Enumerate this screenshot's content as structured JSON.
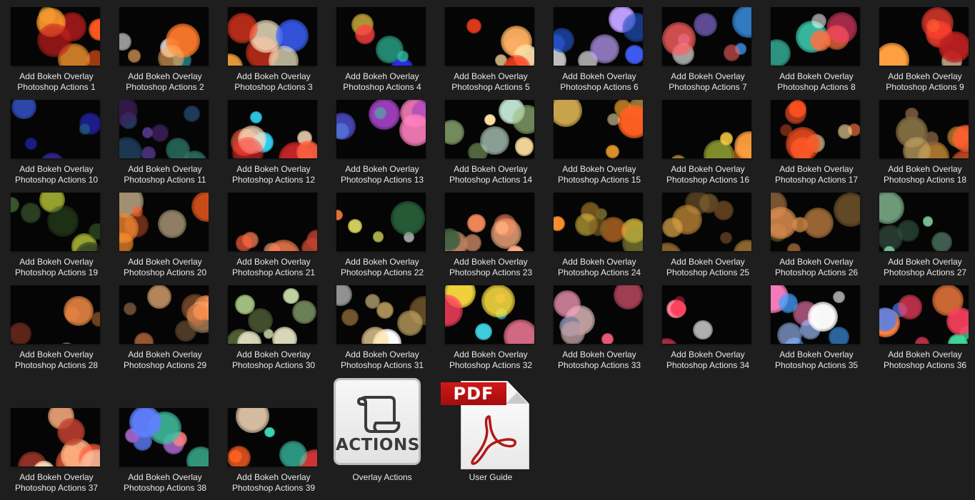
{
  "items": [
    {
      "line1": "Add Bokeh Overlay",
      "line2": "Photoshop Actions 1",
      "type": "image"
    },
    {
      "line1": "Add Bokeh Overlay",
      "line2": "Photoshop Actions 2",
      "type": "image"
    },
    {
      "line1": "Add Bokeh Overlay",
      "line2": "Photoshop Actions 3",
      "type": "image"
    },
    {
      "line1": "Add Bokeh Overlay",
      "line2": "Photoshop Actions 4",
      "type": "image"
    },
    {
      "line1": "Add Bokeh Overlay",
      "line2": "Photoshop Actions 5",
      "type": "image"
    },
    {
      "line1": "Add Bokeh Overlay",
      "line2": "Photoshop Actions 6",
      "type": "image"
    },
    {
      "line1": "Add Bokeh Overlay",
      "line2": "Photoshop Actions 7",
      "type": "image"
    },
    {
      "line1": "Add Bokeh Overlay",
      "line2": "Photoshop Actions 8",
      "type": "image"
    },
    {
      "line1": "Add Bokeh Overlay",
      "line2": "Photoshop Actions 9",
      "type": "image"
    },
    {
      "line1": "Add Bokeh Overlay",
      "line2": "Photoshop Actions 10",
      "type": "image"
    },
    {
      "line1": "Add Bokeh Overlay",
      "line2": "Photoshop Actions 11",
      "type": "image"
    },
    {
      "line1": "Add Bokeh Overlay",
      "line2": "Photoshop Actions 12",
      "type": "image"
    },
    {
      "line1": "Add Bokeh Overlay",
      "line2": "Photoshop Actions 13",
      "type": "image"
    },
    {
      "line1": "Add Bokeh Overlay",
      "line2": "Photoshop Actions 14",
      "type": "image"
    },
    {
      "line1": "Add Bokeh Overlay",
      "line2": "Photoshop Actions 15",
      "type": "image"
    },
    {
      "line1": "Add Bokeh Overlay",
      "line2": "Photoshop Actions 16",
      "type": "image"
    },
    {
      "line1": "Add Bokeh Overlay",
      "line2": "Photoshop Actions 17",
      "type": "image"
    },
    {
      "line1": "Add Bokeh Overlay",
      "line2": "Photoshop Actions 18",
      "type": "image"
    },
    {
      "line1": "Add Bokeh Overlay",
      "line2": "Photoshop Actions 19",
      "type": "image"
    },
    {
      "line1": "Add Bokeh Overlay",
      "line2": "Photoshop Actions 20",
      "type": "image"
    },
    {
      "line1": "Add Bokeh Overlay",
      "line2": "Photoshop Actions 21",
      "type": "image"
    },
    {
      "line1": "Add Bokeh Overlay",
      "line2": "Photoshop Actions 22",
      "type": "image"
    },
    {
      "line1": "Add Bokeh Overlay",
      "line2": "Photoshop Actions 23",
      "type": "image"
    },
    {
      "line1": "Add Bokeh Overlay",
      "line2": "Photoshop Actions 24",
      "type": "image"
    },
    {
      "line1": "Add Bokeh Overlay",
      "line2": "Photoshop Actions 25",
      "type": "image"
    },
    {
      "line1": "Add Bokeh Overlay",
      "line2": "Photoshop Actions 26",
      "type": "image"
    },
    {
      "line1": "Add Bokeh Overlay",
      "line2": "Photoshop Actions 27",
      "type": "image"
    },
    {
      "line1": "Add Bokeh Overlay",
      "line2": "Photoshop Actions 28",
      "type": "image"
    },
    {
      "line1": "Add Bokeh Overlay",
      "line2": "Photoshop Actions 29",
      "type": "image"
    },
    {
      "line1": "Add Bokeh Overlay",
      "line2": "Photoshop Actions 30",
      "type": "image"
    },
    {
      "line1": "Add Bokeh Overlay",
      "line2": "Photoshop Actions 31",
      "type": "image"
    },
    {
      "line1": "Add Bokeh Overlay",
      "line2": "Photoshop Actions 32",
      "type": "image"
    },
    {
      "line1": "Add Bokeh Overlay",
      "line2": "Photoshop Actions 33",
      "type": "image"
    },
    {
      "line1": "Add Bokeh Overlay",
      "line2": "Photoshop Actions 34",
      "type": "image"
    },
    {
      "line1": "Add Bokeh Overlay",
      "line2": "Photoshop Actions 35",
      "type": "image"
    },
    {
      "line1": "Add Bokeh Overlay",
      "line2": "Photoshop Actions 36",
      "type": "image"
    },
    {
      "line1": "Add Bokeh Overlay",
      "line2": "Photoshop Actions 37",
      "type": "image"
    },
    {
      "line1": "Add Bokeh Overlay",
      "line2": "Photoshop Actions 38",
      "type": "image"
    },
    {
      "line1": "Add Bokeh Overlay",
      "line2": "Photoshop Actions 39",
      "type": "image"
    },
    {
      "line1": "Overlay Actions",
      "line2": "",
      "type": "actions",
      "icon": "actions-scroll-icon",
      "icon_text": "ACTIONS"
    },
    {
      "line1": "User Guide",
      "line2": "",
      "type": "pdf",
      "icon": "pdf-icon",
      "icon_text": "PDF"
    }
  ],
  "palettes": [
    [
      "#ff5a1e",
      "#ff9a2e",
      "#c81e1e",
      "#ffcc55"
    ],
    [
      "#ffb060",
      "#ffffff",
      "#2a8a8a",
      "#ff7a2a"
    ],
    [
      "#ff3a20",
      "#fff2d0",
      "#3a60ff",
      "#ffaa40"
    ],
    [
      "#30c0a0",
      "#e0c040",
      "#3030ff",
      "#ff4040"
    ],
    [
      "#ff4020",
      "#ffb060",
      "#8080ff",
      "#ffe0a0"
    ],
    [
      "#4060ff",
      "#ffffff",
      "#c0a0ff",
      "#2050c0"
    ],
    [
      "#a080ff",
      "#40a0ff",
      "#ff6060",
      "#ffffff"
    ],
    [
      "#40e0c0",
      "#ff7040",
      "#ff4070",
      "#ffffff"
    ],
    [
      "#ff4030",
      "#ffa040",
      "#ffe0b0",
      "#c02020"
    ],
    [
      "#2020a0",
      "#4030c0",
      "#206080",
      "#3050c0"
    ],
    [
      "#204060",
      "#6040a0",
      "#308070",
      "#402060"
    ],
    [
      "#30d0f0",
      "#ff6040",
      "#ffe0c0",
      "#ff3030"
    ],
    [
      "#a040c0",
      "#40c0a0",
      "#ff80c0",
      "#6060ff"
    ],
    [
      "#c0e0d0",
      "#a0c080",
      "#ffe0a0",
      "#80a060"
    ],
    [
      "#ffd060",
      "#ffaa30",
      "#ff6020",
      "#fff0b0"
    ],
    [
      "#ffd040",
      "#c0d040",
      "#ff8020",
      "#ffa040"
    ],
    [
      "#ff5020",
      "#ffe0a0",
      "#ff8040",
      "#c04020"
    ],
    [
      "#ffb040",
      "#c0a060",
      "#ff6030",
      "#806040"
    ],
    [
      "#e0f040",
      "#406030",
      "#305020",
      "#203020"
    ],
    [
      "#ff9030",
      "#ffe0b0",
      "#ff6020",
      "#a04020"
    ],
    [
      "#ff8050",
      "#ff6040",
      "#c04030",
      "#ffb080"
    ],
    [
      "#e0e060",
      "#ffffff",
      "#ff8040",
      "#40a060"
    ],
    [
      "#ffb080",
      "#ff9060",
      "#406040",
      "#c08060"
    ],
    [
      "#e0c040",
      "#a0a040",
      "#ff9030",
      "#806020"
    ],
    [
      "#c09040",
      "#806030",
      "#e0a040",
      "#604020"
    ],
    [
      "#c08040",
      "#e09050",
      "#806030",
      "#a07040"
    ],
    [
      "#80d0a0",
      "#406050",
      "#a0e0b0",
      "#305040"
    ],
    [
      "#e08040",
      "#c07030",
      "#803020",
      "#ffb070"
    ],
    [
      "#ff9050",
      "#c07040",
      "#806040",
      "#ffc080"
    ],
    [
      "#a0c080",
      "#c0d0a0",
      "#607040",
      "#e0e0c0"
    ],
    [
      "#ffe0a0",
      "#ffffff",
      "#806030",
      "#c0a060"
    ],
    [
      "#ff4060",
      "#40d0e0",
      "#ffe040",
      "#ff80a0"
    ],
    [
      "#ff6080",
      "#c0a0a0",
      "#8080a0",
      "#ffa0c0"
    ],
    [
      "#ff4060",
      "#ff90a0",
      "#c02040",
      "#ffffff"
    ],
    [
      "#40a0ff",
      "#ff80c0",
      "#a0c0ff",
      "#ffffff"
    ],
    [
      "#ff4060",
      "#40e0a0",
      "#4080ff",
      "#ff8040"
    ],
    [
      "#ff6040",
      "#ffb080",
      "#c04030",
      "#ffe0c0"
    ],
    [
      "#40c0a0",
      "#a060c0",
      "#6080ff",
      "#ff8080"
    ],
    [
      "#ff6020",
      "#40e0c0",
      "#ffe0c0",
      "#ff4040"
    ]
  ]
}
